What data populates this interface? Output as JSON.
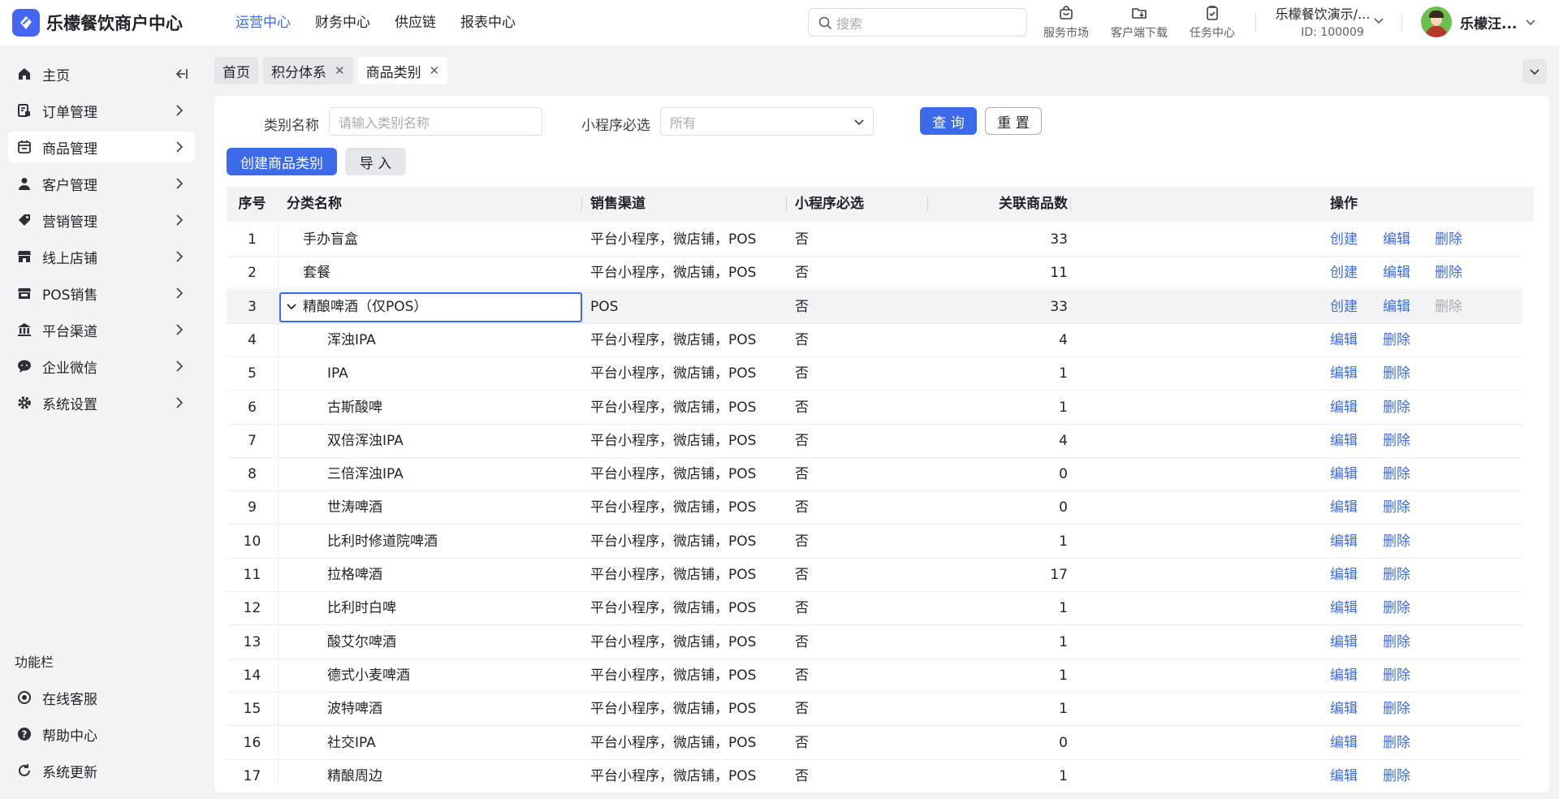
{
  "app": {
    "title": "乐檬餐饮商户中心"
  },
  "topnav": [
    "运营中心",
    "财务中心",
    "供应链",
    "报表中心"
  ],
  "search": {
    "placeholder": "搜索"
  },
  "tools": [
    "服务市场",
    "客户端下载",
    "任务中心"
  ],
  "store": {
    "name": "乐檬餐饮演示/...",
    "id": "ID: 100009"
  },
  "user": {
    "name": "乐檬汪..."
  },
  "sidebar": {
    "items": [
      "主页",
      "订单管理",
      "商品管理",
      "客户管理",
      "营销管理",
      "线上店铺",
      "POS销售",
      "平台渠道",
      "企业微信",
      "系统设置"
    ],
    "func_title": "功能栏",
    "func_items": [
      "在线客服",
      "帮助中心",
      "系统更新"
    ]
  },
  "tabs": [
    "首页",
    "积分体系",
    "商品类别"
  ],
  "filter": {
    "name_label": "类别名称",
    "name_placeholder": "请输入类别名称",
    "required_label": "小程序必选",
    "required_value": "所有",
    "query_btn": "查 询",
    "reset_btn": "重 置"
  },
  "actions": {
    "create": "创建商品类别",
    "import": "导 入"
  },
  "table": {
    "columns": [
      "序号",
      "分类名称",
      "销售渠道",
      "小程序必选",
      "关联商品数",
      "操作"
    ],
    "op_create": "创建",
    "op_edit": "编辑",
    "op_delete": "删除",
    "rows": [
      {
        "no": "1",
        "name": "手办盲盒",
        "channel": "平台小程序，微店铺，POS",
        "required": "否",
        "count": "33"
      },
      {
        "no": "2",
        "name": "套餐",
        "channel": "平台小程序，微店铺，POS",
        "required": "否",
        "count": "11"
      },
      {
        "no": "3",
        "name": "精酿啤酒（仅POS）",
        "channel": "POS",
        "required": "否",
        "count": "33"
      },
      {
        "no": "4",
        "name": "浑浊IPA",
        "channel": "平台小程序，微店铺，POS",
        "required": "否",
        "count": "4"
      },
      {
        "no": "5",
        "name": "IPA",
        "channel": "平台小程序，微店铺，POS",
        "required": "否",
        "count": "1"
      },
      {
        "no": "6",
        "name": "古斯酸啤",
        "channel": "平台小程序，微店铺，POS",
        "required": "否",
        "count": "1"
      },
      {
        "no": "7",
        "name": "双倍浑浊IPA",
        "channel": "平台小程序，微店铺，POS",
        "required": "否",
        "count": "4"
      },
      {
        "no": "8",
        "name": "三倍浑浊IPA",
        "channel": "平台小程序，微店铺，POS",
        "required": "否",
        "count": "0"
      },
      {
        "no": "9",
        "name": "世涛啤酒",
        "channel": "平台小程序，微店铺，POS",
        "required": "否",
        "count": "0"
      },
      {
        "no": "10",
        "name": "比利时修道院啤酒",
        "channel": "平台小程序，微店铺，POS",
        "required": "否",
        "count": "1"
      },
      {
        "no": "11",
        "name": "拉格啤酒",
        "channel": "平台小程序，微店铺，POS",
        "required": "否",
        "count": "17"
      },
      {
        "no": "12",
        "name": "比利时白啤",
        "channel": "平台小程序，微店铺，POS",
        "required": "否",
        "count": "1"
      },
      {
        "no": "13",
        "name": "酸艾尔啤酒",
        "channel": "平台小程序，微店铺，POS",
        "required": "否",
        "count": "1"
      },
      {
        "no": "14",
        "name": "德式小麦啤酒",
        "channel": "平台小程序，微店铺，POS",
        "required": "否",
        "count": "1"
      },
      {
        "no": "15",
        "name": "波特啤酒",
        "channel": "平台小程序，微店铺，POS",
        "required": "否",
        "count": "1"
      },
      {
        "no": "16",
        "name": "社交IPA",
        "channel": "平台小程序，微店铺，POS",
        "required": "否",
        "count": "0"
      },
      {
        "no": "17",
        "name": "精酿周边",
        "channel": "平台小程序，微店铺，POS",
        "required": "否",
        "count": "1"
      }
    ]
  },
  "colors": {
    "accent": "#3c6ae8",
    "bg": "#f2f3f5",
    "disabled": "#a8abb2"
  }
}
